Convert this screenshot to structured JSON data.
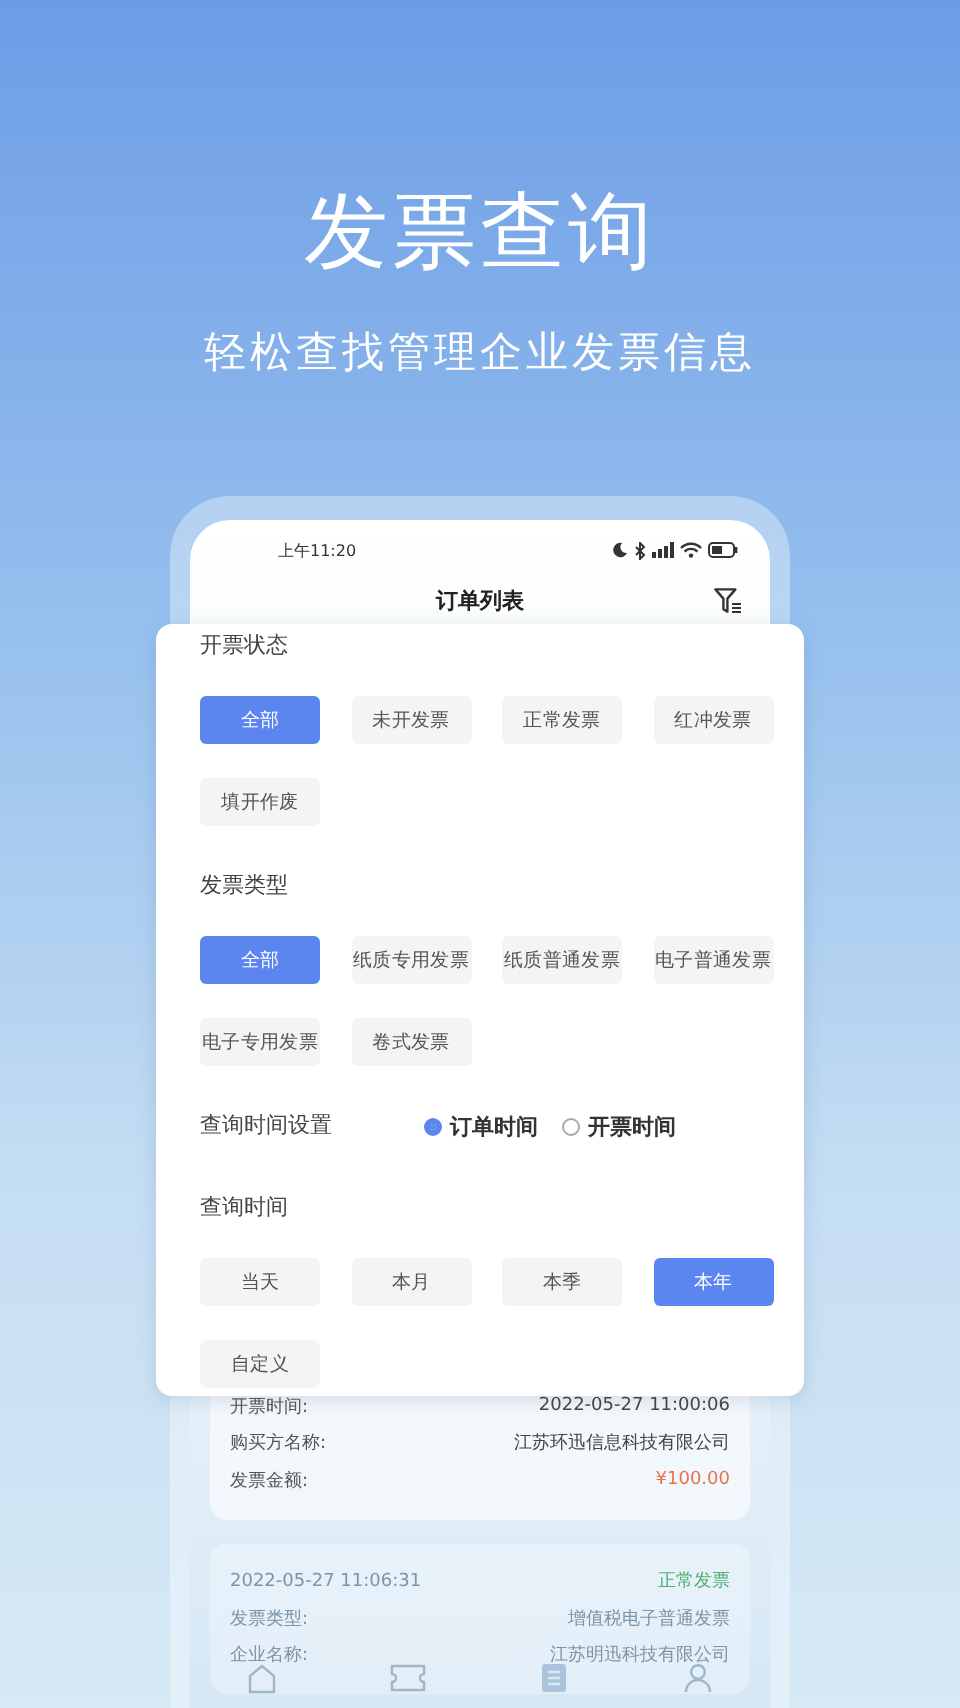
{
  "headline": {
    "title": "发票查询",
    "subtitle": "轻松查找管理企业发票信息"
  },
  "phone": {
    "status_bar": {
      "time": "上午11:20"
    },
    "header": {
      "title": "订单列表"
    },
    "filter_panel": {
      "sections": [
        {
          "kind": "chips",
          "label": "开票状态",
          "options": [
            {
              "label": "全部",
              "selected": true
            },
            {
              "label": "未开发票",
              "selected": false
            },
            {
              "label": "正常发票",
              "selected": false
            },
            {
              "label": "红冲发票",
              "selected": false
            },
            {
              "label": "填开作废",
              "selected": false
            }
          ]
        },
        {
          "kind": "chips",
          "label": "发票类型",
          "options": [
            {
              "label": "全部",
              "selected": true
            },
            {
              "label": "纸质专用发票",
              "selected": false
            },
            {
              "label": "纸质普通发票",
              "selected": false
            },
            {
              "label": "电子普通发票",
              "selected": false
            },
            {
              "label": "电子专用发票",
              "selected": false
            },
            {
              "label": "卷式发票",
              "selected": false
            }
          ]
        },
        {
          "kind": "radio",
          "label": "查询时间设置",
          "options": [
            {
              "label": "订单时间",
              "selected": true
            },
            {
              "label": "开票时间",
              "selected": false
            }
          ]
        },
        {
          "kind": "chips",
          "label": "查询时间",
          "options": [
            {
              "label": "当天",
              "selected": false
            },
            {
              "label": "本月",
              "selected": false
            },
            {
              "label": "本季",
              "selected": false
            },
            {
              "label": "本年",
              "selected": true
            },
            {
              "label": "自定义",
              "selected": false
            }
          ]
        }
      ]
    },
    "cards": [
      {
        "rows": [
          {
            "label": "开票时间:",
            "value": "2022-05-27 11:00:06",
            "kind": "plain"
          },
          {
            "label": "购买方名称:",
            "value": "江苏环迅信息科技有限公司",
            "kind": "plain"
          },
          {
            "label": "发票金额:",
            "value": "¥100.00",
            "kind": "amount"
          }
        ]
      },
      {
        "date": "2022-05-27 11:06:31",
        "status": "正常发票",
        "rows": [
          {
            "label": "发票类型:",
            "value": "增值税电子普通发票",
            "kind": "plain"
          },
          {
            "label": "企业名称:",
            "value": "江苏明迅科技有限公司",
            "kind": "plain"
          }
        ]
      }
    ]
  }
}
